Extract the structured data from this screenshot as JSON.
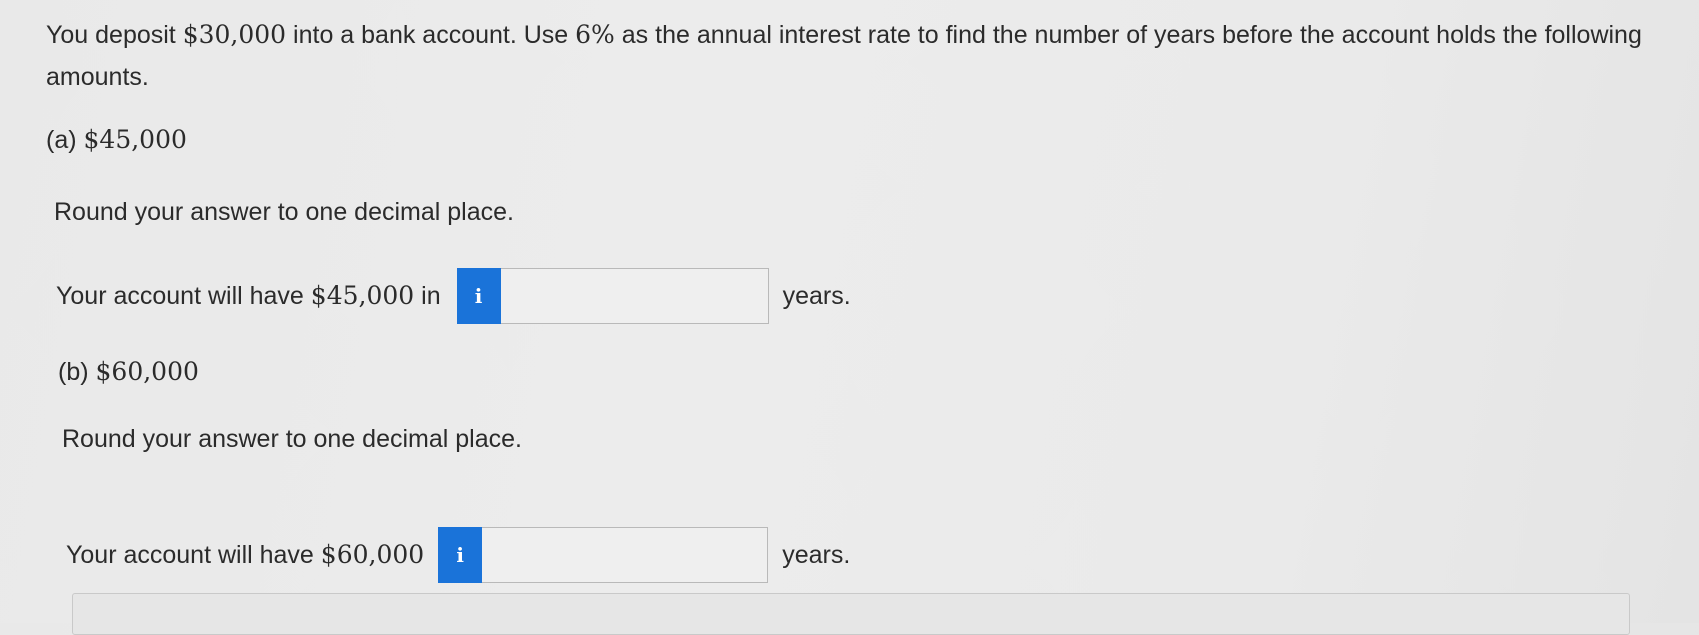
{
  "problem": {
    "text_before_deposit": "You deposit ",
    "deposit": "$30,000",
    "text_before_rate": " into a bank account. Use ",
    "rate": "6%",
    "text_after_rate": " as the annual interest rate to find the number of years before the account holds the following amounts."
  },
  "part_a": {
    "label": "(a)",
    "amount": "$45,000",
    "instruction": "Round your answer to one decimal place.",
    "answer_prefix_text": "Your account will have ",
    "answer_prefix_amount": "$45,000",
    "answer_prefix_end": " in",
    "info_icon": "i",
    "input_value": "",
    "suffix": "years."
  },
  "part_b": {
    "label": "(b)",
    "amount": "$60,000",
    "instruction": "Round your answer to one decimal place.",
    "answer_prefix_text": "Your account will have ",
    "answer_prefix_amount": "$60,000",
    "info_icon": "i",
    "input_value": "",
    "suffix": "years."
  },
  "colors": {
    "info_button": "#1a73d9",
    "text": "#2b2b2b",
    "background": "#ebebeb"
  }
}
